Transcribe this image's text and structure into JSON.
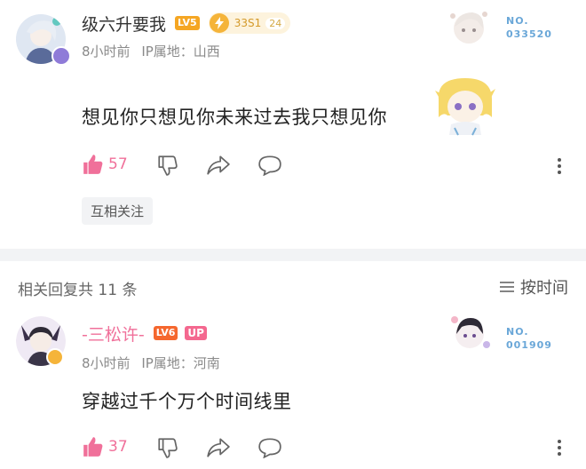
{
  "comment1": {
    "username": "级六升要我",
    "level": "LV5",
    "fan_badge": "33S1",
    "fan_badge_num": "24",
    "time": "8小时前",
    "ip": "IP属地：山西",
    "no_label": "NO.",
    "no_value": "033520",
    "text": "想见你只想见你未来过去我只想见你",
    "likes": "57",
    "tag": "互相关注"
  },
  "replies_header": {
    "title": "相关回复共 11 条",
    "sort_label": "按时间"
  },
  "comment2": {
    "username": "-三松许-",
    "level": "LV6",
    "up_badge": "UP",
    "time": "8小时前",
    "ip": "IP属地：河南",
    "no_label": "NO.",
    "no_value": "001909",
    "text": "穿越过千个万个时间线里",
    "likes": "37"
  },
  "colors": {
    "like": "#f0709a",
    "up_badge": "#f4688f",
    "lv5": "#f5a623",
    "lv6": "#f5672e",
    "username2": "#f0709a"
  }
}
